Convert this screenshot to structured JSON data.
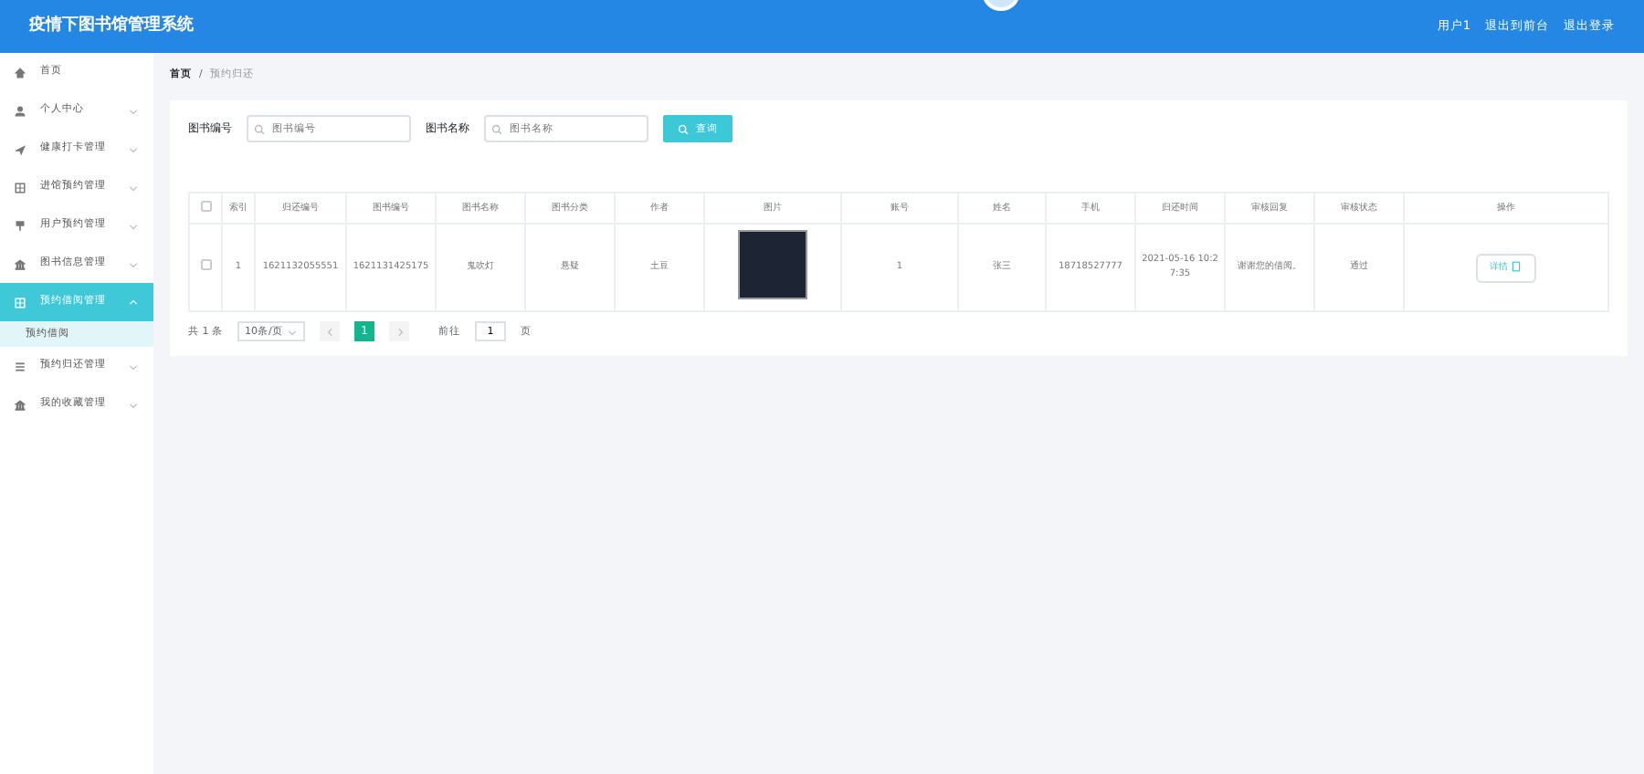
{
  "header": {
    "title": "疫情下图书馆管理系统",
    "links": [
      "用户1",
      "退出到前台",
      "退出登录"
    ]
  },
  "sidebar": {
    "items": [
      {
        "kind": "link",
        "label": "首页",
        "selected": false
      },
      {
        "kind": "menu",
        "label": "个人中心",
        "selected": false,
        "expanded": false
      },
      {
        "kind": "menu",
        "label": "健康打卡管理",
        "selected": false,
        "expanded": false
      },
      {
        "kind": "menu",
        "label": "进馆预约管理",
        "selected": false,
        "expanded": false
      },
      {
        "kind": "menu",
        "label": "用户预约管理",
        "selected": false,
        "expanded": false
      },
      {
        "kind": "menu",
        "label": "图书信息管理",
        "selected": false,
        "expanded": false
      },
      {
        "kind": "menu",
        "label": "预约借阅管理",
        "selected": true,
        "expanded": true,
        "children": [
          {
            "label": "预约借阅"
          }
        ]
      },
      {
        "kind": "menu",
        "label": "预约归还管理",
        "selected": false,
        "expanded": false
      },
      {
        "kind": "menu",
        "label": "我的收藏管理",
        "selected": false,
        "expanded": false
      }
    ]
  },
  "breadcrumb": {
    "items": [
      "首页",
      "预约归还"
    ],
    "separator": "/"
  },
  "search": {
    "fields": [
      {
        "label": "图书编号",
        "placeholder": "图书编号"
      },
      {
        "label": "图书名称",
        "placeholder": "图书名称"
      }
    ],
    "button": "查询"
  },
  "table": {
    "all_checked": false,
    "columns": [
      "索引",
      "归还编号",
      "图书编号",
      "图书名称",
      "图书分类",
      "作者",
      "图片",
      "账号",
      "姓名",
      "手机",
      "归还时间",
      "审核回复",
      "审核状态",
      "操作"
    ],
    "rows": [
      {
        "checked": false,
        "cells": [
          "1",
          "1621132055551",
          "1621131425175",
          "鬼吹灯",
          "悬疑",
          "土豆",
          "",
          "1",
          "张三",
          "18718527777",
          "2021-05-16 10:27:35",
          "谢谢您的借阅。",
          "通过"
        ],
        "action": "详情"
      }
    ]
  },
  "pagination": {
    "total": "共 1 条",
    "page_size": "10条/页",
    "pages": [
      {
        "label": "1",
        "selected": true
      }
    ],
    "goto": "前往",
    "goto_value": "1",
    "page_unit": "页"
  }
}
